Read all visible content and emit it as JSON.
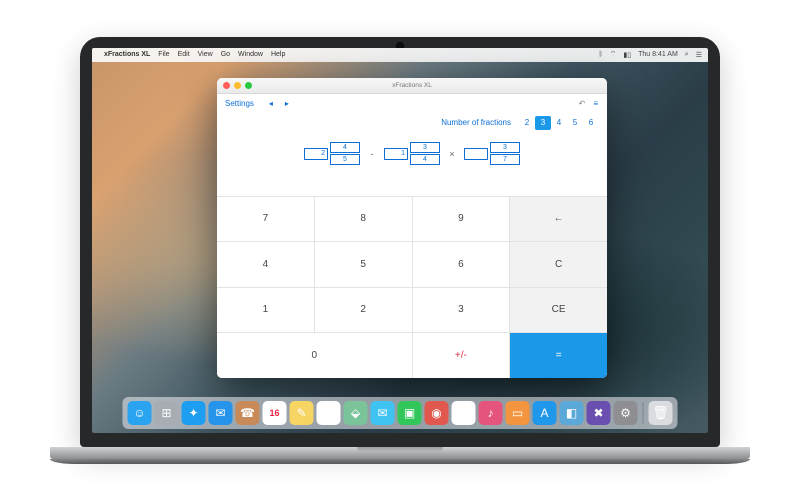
{
  "menubar": {
    "app_name": "xFractions XL",
    "items": [
      "File",
      "Edit",
      "View",
      "Go",
      "Window",
      "Help"
    ],
    "clock": "Thu 8:41 AM"
  },
  "window": {
    "title": "xFractions XL",
    "toolbar": {
      "settings_label": "Settings"
    },
    "number_of_fractions": {
      "label": "Number of fractions",
      "options": [
        "2",
        "3",
        "4",
        "5",
        "6"
      ],
      "selected": "3"
    },
    "expression": {
      "fractions": [
        {
          "whole": "2",
          "num": "4",
          "den": "5"
        },
        {
          "whole": "1",
          "num": "3",
          "den": "4"
        },
        {
          "whole": "",
          "num": "3",
          "den": "7"
        }
      ],
      "operators": [
        "-",
        "×"
      ]
    },
    "keypad": {
      "k7": "7",
      "k8": "8",
      "k9": "9",
      "back": "←",
      "k4": "4",
      "k5": "5",
      "k6": "6",
      "clear": "C",
      "k1": "1",
      "k2": "2",
      "k3": "3",
      "ce": "CE",
      "k0": "0",
      "pm": "+/-",
      "eq": "="
    }
  },
  "dock": {
    "items": [
      {
        "n": "finder",
        "c": "#2aa4f0",
        "g": "☺"
      },
      {
        "n": "launchpad",
        "c": "#a8adb3",
        "g": "⊞"
      },
      {
        "n": "safari",
        "c": "#1e9ef0",
        "g": "✦"
      },
      {
        "n": "mail",
        "c": "#2694ea",
        "g": "✉"
      },
      {
        "n": "contacts",
        "c": "#c78a58",
        "g": "☎"
      },
      {
        "n": "calendar",
        "c": "#fff",
        "g": "16"
      },
      {
        "n": "notes",
        "c": "#f6d563",
        "g": "✎"
      },
      {
        "n": "reminders",
        "c": "#fff",
        "g": "☑"
      },
      {
        "n": "maps",
        "c": "#7bc49a",
        "g": "⬙"
      },
      {
        "n": "messages",
        "c": "#3fc3f2",
        "g": "✉"
      },
      {
        "n": "facetime",
        "c": "#32c75a",
        "g": "▣"
      },
      {
        "n": "photobooth",
        "c": "#e0584e",
        "g": "◉"
      },
      {
        "n": "photos",
        "c": "#fff",
        "g": "✿"
      },
      {
        "n": "itunes",
        "c": "#e5547c",
        "g": "♪"
      },
      {
        "n": "ibooks",
        "c": "#f2953e",
        "g": "▭"
      },
      {
        "n": "appstore",
        "c": "#1f97ea",
        "g": "A"
      },
      {
        "n": "preview",
        "c": "#5aa9d8",
        "g": "◧"
      },
      {
        "n": "xfractions",
        "c": "#6a4fb0",
        "g": "✖"
      },
      {
        "n": "prefs",
        "c": "#8e8e93",
        "g": "⚙"
      }
    ],
    "trash": {
      "n": "trash",
      "c": "#dadce0",
      "g": "🗑"
    }
  }
}
